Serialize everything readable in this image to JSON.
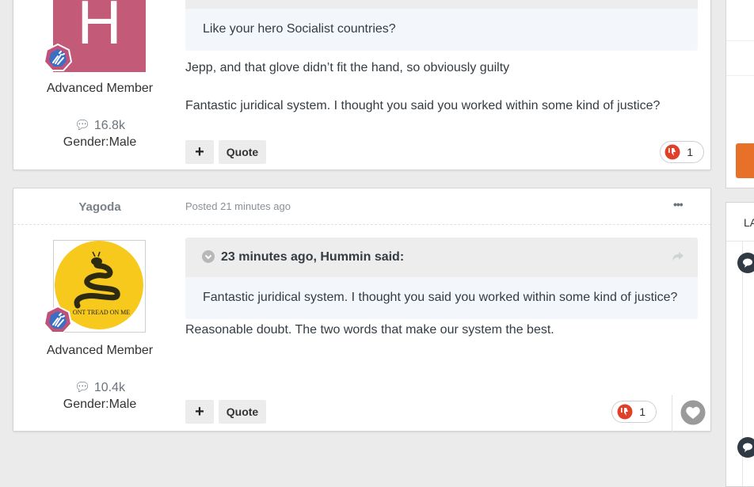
{
  "post1": {
    "rank": "Advanced Member",
    "post_count": "16.8k",
    "gender": "Gender:Male",
    "quote_body": "Like your hero Socialist countries?",
    "lines": [
      "Jepp, and that glove didn’t fit the hand, so obviously guilty",
      "Fantastic juridical system. I thought you said you worked within some kind of  justice?"
    ],
    "quote_button": "Quote",
    "plus_button": "+",
    "reaction_count": "1"
  },
  "post2": {
    "author": "Yagoda",
    "posted": "Posted 21 minutes ago",
    "menu": "•••",
    "rank": "Advanced Member",
    "post_count": "10.4k",
    "gender": "Gender:Male",
    "quote_head": "23 minutes ago, Hummin said:",
    "quote_body": "Fantastic juridical system. I thought you said you worked within some kind of  justice?",
    "text": "Reasonable doubt. The two words that make our system the best.",
    "quote_button": "Quote",
    "plus_button": "+",
    "reaction_count": "1",
    "avatar_caption": "ONT TREAD ON ME"
  },
  "avatar_letter": "H",
  "sidebar": {
    "header_fragment": "LA"
  },
  "colors": {
    "avatar_h": "#c25a78",
    "badge": "#c0527a",
    "reaction": "#e0402a",
    "sidebar_button": "#e8712a"
  }
}
